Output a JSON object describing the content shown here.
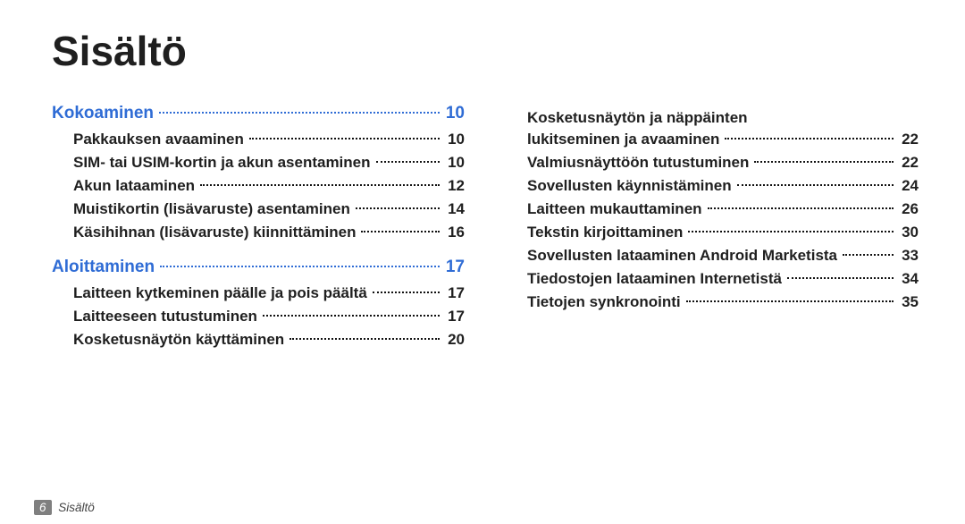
{
  "title": "Sisältö",
  "sections": [
    {
      "label": "Kokoaminen",
      "page": "10"
    },
    {
      "label": "Aloittaminen",
      "page": "17"
    }
  ],
  "left_subs_a": [
    {
      "label": "Pakkauksen avaaminen",
      "page": "10"
    },
    {
      "label": "SIM- tai USIM-kortin ja akun asentaminen",
      "page": "10"
    },
    {
      "label": "Akun lataaminen",
      "page": "12"
    },
    {
      "label": "Muistikortin (lisävaruste) asentaminen",
      "page": "14"
    },
    {
      "label": "Käsihihnan (lisävaruste) kiinnittäminen",
      "page": "16"
    }
  ],
  "left_subs_b": [
    {
      "label": "Laitteen kytkeminen päälle ja pois päältä",
      "page": "17"
    },
    {
      "label": "Laitteeseen tutustuminen",
      "page": "17"
    },
    {
      "label": "Kosketusnäytön käyttäminen",
      "page": "20"
    }
  ],
  "right_subs": [
    {
      "label1": "Kosketusnäytön ja näppäinten",
      "label2": "lukitseminen ja avaaminen",
      "page": "22",
      "two_line": true
    },
    {
      "label": "Valmiusnäyttöön tutustuminen",
      "page": "22"
    },
    {
      "label": "Sovellusten käynnistäminen",
      "page": "24"
    },
    {
      "label": "Laitteen mukauttaminen",
      "page": "26"
    },
    {
      "label": "Tekstin kirjoittaminen",
      "page": "30"
    },
    {
      "label": "Sovellusten lataaminen Android Marketista",
      "page": "33"
    },
    {
      "label": "Tiedostojen lataaminen Internetistä",
      "page": "34"
    },
    {
      "label": "Tietojen synkronointi",
      "page": "35"
    }
  ],
  "footer": {
    "page_number": "6",
    "doc_title": "Sisältö"
  }
}
